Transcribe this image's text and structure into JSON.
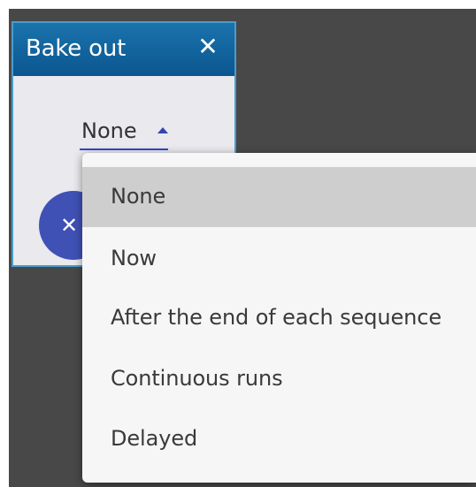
{
  "dialog": {
    "title": "Bake out",
    "close_glyph": "✕",
    "select_value": "None",
    "fab_glyph": "✕"
  },
  "menu": {
    "items": [
      {
        "label": "None",
        "selected": true
      },
      {
        "label": "Now",
        "selected": false
      },
      {
        "label": "After the end of each sequence",
        "selected": false
      },
      {
        "label": "Continuous runs",
        "selected": false
      },
      {
        "label": "Delayed",
        "selected": false
      }
    ]
  },
  "colors": {
    "title_bar": "#0f5e98",
    "accent": "#3f51b5",
    "selected_item": "#cecece",
    "background": "#484848"
  },
  "icons": {
    "close": "close-icon",
    "dropdown_arrow": "caret-up-icon",
    "fab": "close-icon"
  }
}
